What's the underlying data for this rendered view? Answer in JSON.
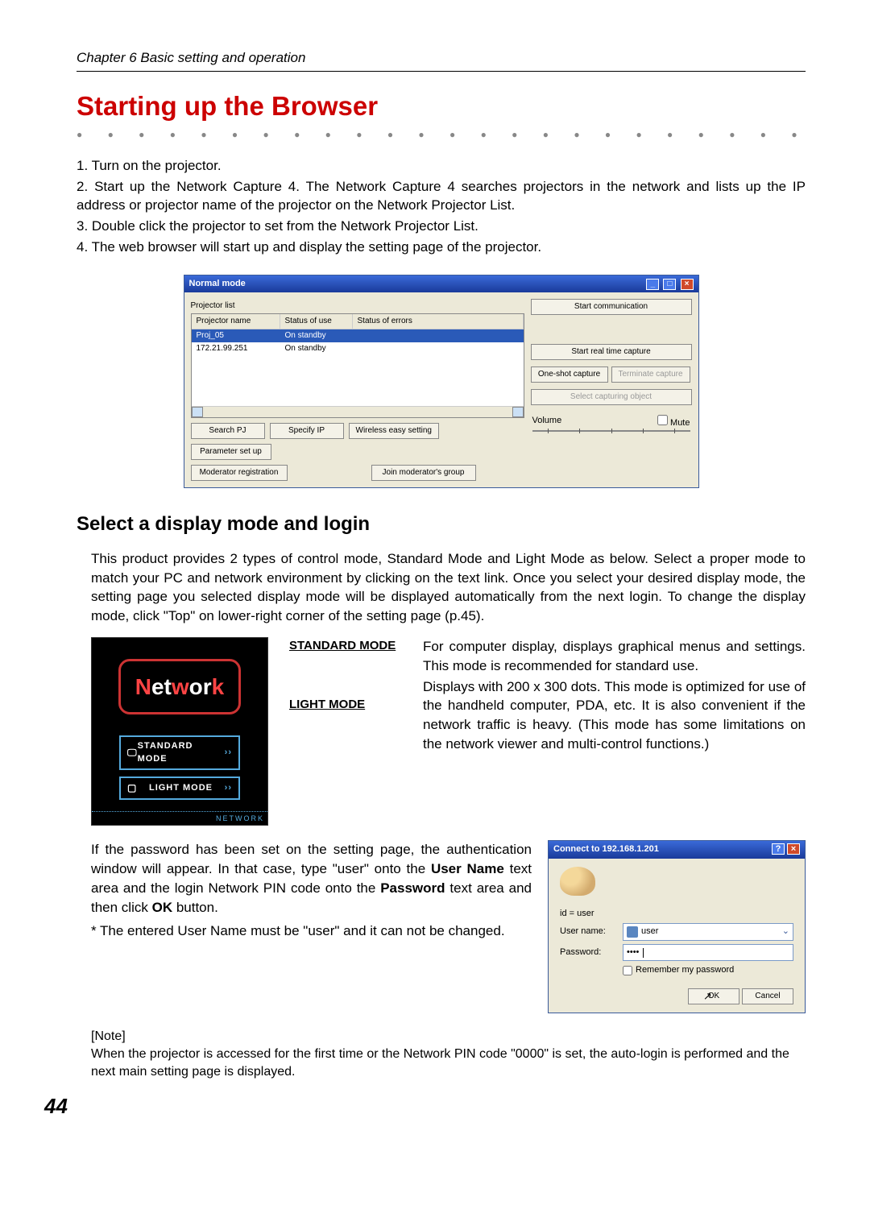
{
  "chapter": "Chapter 6 Basic setting and operation",
  "title": "Starting up the Browser",
  "steps": [
    "1. Turn on the projector.",
    "2. Start up the Network Capture 4. The Network Capture 4 searches projectors in the network and lists up the IP address or projector name of the projector on the Network Projector List.",
    "3. Double click the projector to set from the Network Projector List.",
    "4. The web browser will start up and display the setting page of the projector."
  ],
  "app_window": {
    "title": "Normal mode",
    "list_label": "Projector list",
    "headers": [
      "Projector name",
      "Status of use",
      "Status of errors"
    ],
    "rows": [
      {
        "name": "Proj_05",
        "status": "On standby",
        "err": ""
      },
      {
        "name": "172.21.99.251",
        "status": "On standby",
        "err": ""
      }
    ],
    "buttons": {
      "start_comm": "Start communication",
      "start_rtc": "Start real time capture",
      "one_shot": "One-shot capture",
      "terminate": "Terminate capture",
      "select_obj": "Select capturing object",
      "search_pj": "Search PJ",
      "specify_ip": "Specify IP",
      "wireless_easy": "Wireless easy setting",
      "mod_reg": "Moderator registration",
      "join_mod": "Join moderator's group",
      "param_setup": "Parameter set up"
    },
    "volume_label": "Volume",
    "mute_label": "Mute"
  },
  "section2_title": "Select a display mode and login",
  "section2_para": "This product provides 2 types of control mode, Standard Mode and Light Mode as below. Select a proper mode to match your PC and network environment by clicking on the text link. Once you select your desired display mode, the setting page you selected display mode will be displayed automatically from the next login. To change the display mode, click \"Top\" on lower-right corner of the setting page (p.45).",
  "mode_screenshot": {
    "logo": "Network",
    "standard": "STANDARD MODE",
    "light": "LIGHT MODE",
    "footer": "NETWORK"
  },
  "mode_labels": {
    "standard": "STANDARD MODE",
    "light": "LIGHT MODE"
  },
  "mode_desc": {
    "standard": "For computer display, displays graphical menus and settings. This mode is recommended for standard use.",
    "light": "Displays with 200 x 300 dots. This mode is optimized for use of the handheld computer, PDA, etc. It is also convenient if the network traffic is heavy. (This mode has some limitations on the network viewer and multi-control functions.)"
  },
  "auth_text": {
    "p1a": "If the password has been set on the setting page, the authentication window will appear. In that case, type \"user\" onto the ",
    "p1b": "User Name",
    "p1c": " text area and the login Network PIN code onto the ",
    "p1d": "Password",
    "p1e": " text area and then click ",
    "p1f": "OK",
    "p1g": " button.",
    "p2": "* The entered User Name must be \"user\" and it can not be changed."
  },
  "auth_dialog": {
    "title": "Connect to 192.168.1.201",
    "id_line": "id = user",
    "username_label": "User name:",
    "username_value": "user",
    "password_label": "Password:",
    "password_value": "••••",
    "remember": "Remember my password",
    "ok": "OK",
    "cancel": "Cancel"
  },
  "note": {
    "label": "[Note]",
    "text": "When the projector is accessed for the first time or the Network PIN code \"0000\" is set, the auto-login is performed and the next main setting page is displayed."
  },
  "page_number": "44"
}
